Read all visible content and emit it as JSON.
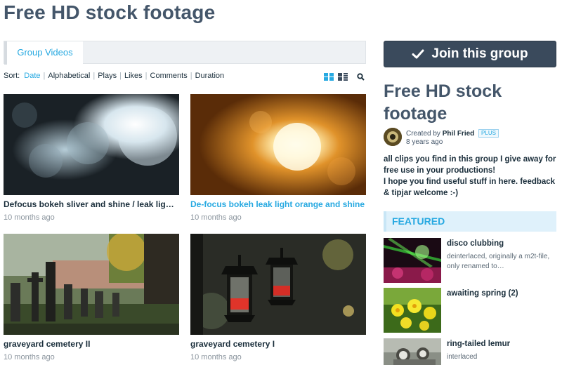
{
  "page_title": "Free HD stock footage",
  "tabs": [
    {
      "label": "Group Videos"
    }
  ],
  "sort": {
    "label": "Sort:",
    "options": [
      "Date",
      "Alphabetical",
      "Plays",
      "Likes",
      "Comments",
      "Duration"
    ],
    "active": "Date"
  },
  "icons": {
    "grid_view": "grid-view-icon",
    "list_view": "list-view-icon",
    "search": "search-icon",
    "checkmark": "checkmark-icon"
  },
  "videos": [
    {
      "title": "Defocus bokeh sliver and shine / leak light strip",
      "age": "10 months ago"
    },
    {
      "title": "De-focus bokeh leak light orange and shine",
      "age": "10 months ago"
    },
    {
      "title": "graveyard cemetery II",
      "age": "10 months ago"
    },
    {
      "title": "graveyard cemetery I",
      "age": "10 months ago"
    }
  ],
  "sidebar": {
    "join_label": "Join this group",
    "group_title": "Free HD stock footage",
    "created_by_label": "Created by",
    "creator_name": "Phil Fried",
    "creator_badge": "PLUS",
    "created_age": "8 years ago",
    "description": [
      "all clips you find in this group I give away for free use in your productions!",
      "I hope you find useful stuff in here. feedback & tipjar welcome :-)"
    ],
    "featured_label": "FEATURED",
    "featured": [
      {
        "title": "disco clubbing",
        "desc": "deinterlaced, originally a m2t-file, only renamed to…"
      },
      {
        "title": "awaiting spring (2)",
        "desc": ""
      },
      {
        "title": "ring-tailed lemur",
        "desc": "interlaced"
      }
    ]
  },
  "colors": {
    "accent": "#27a9e1",
    "title": "#44566a",
    "join_button": "#3a4a5c"
  }
}
